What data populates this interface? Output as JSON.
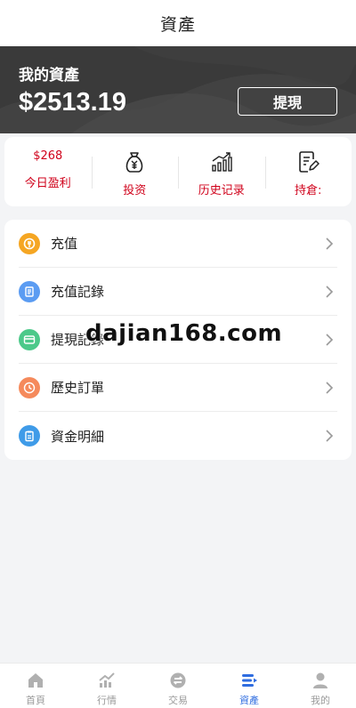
{
  "header": {
    "title": "資產"
  },
  "wallet": {
    "label": "我的資產",
    "amount": "$2513.19",
    "withdraw_label": "提現"
  },
  "stats": {
    "today_profit_value": "$268",
    "today_profit_label": "今日盈利",
    "invest_label": "投资",
    "history_label": "历史记录",
    "holdings_label": "持倉:",
    "accent_color": "#d0021b"
  },
  "menu": {
    "items": [
      {
        "label": "充值",
        "icon": "recharge-icon",
        "color": "#f5a623"
      },
      {
        "label": "充值記錄",
        "icon": "document-icon",
        "color": "#5b9cf2"
      },
      {
        "label": "提現記錄",
        "icon": "card-icon",
        "color": "#4cc98a"
      },
      {
        "label": "歷史訂單",
        "icon": "clock-icon",
        "color": "#f58a5c"
      },
      {
        "label": "資金明細",
        "icon": "clipboard-icon",
        "color": "#3f9be8"
      }
    ]
  },
  "watermark": "dajian168.com",
  "tabbar": {
    "items": [
      {
        "label": "首頁",
        "icon": "home-icon"
      },
      {
        "label": "行情",
        "icon": "chart-icon"
      },
      {
        "label": "交易",
        "icon": "exchange-icon"
      },
      {
        "label": "資產",
        "icon": "assets-icon",
        "active": true
      },
      {
        "label": "我的",
        "icon": "user-icon"
      }
    ],
    "active_color": "#2f6de0"
  }
}
